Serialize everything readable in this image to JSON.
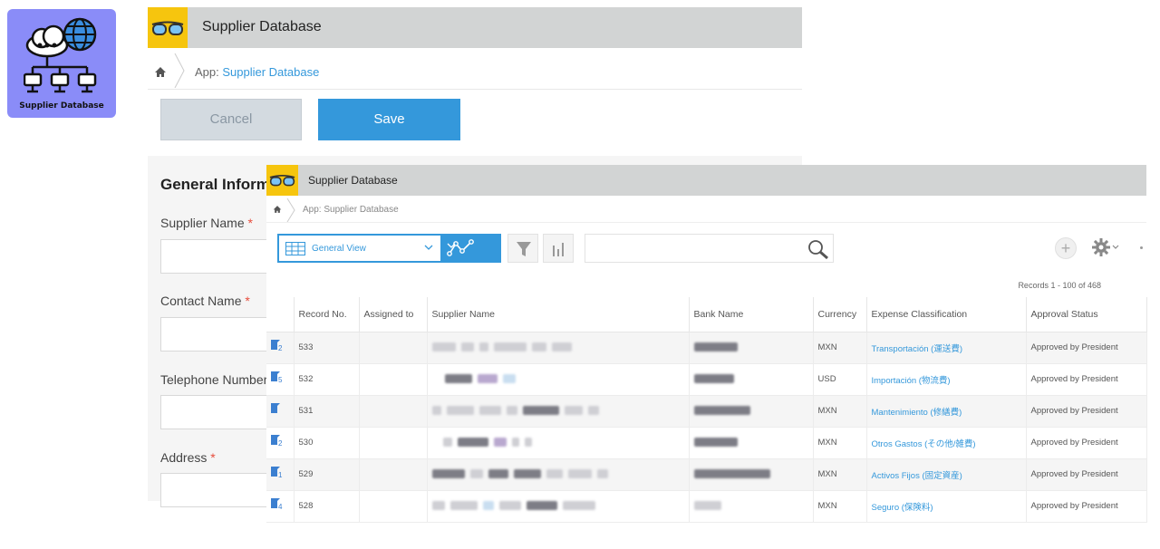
{
  "app_tile": {
    "label": "Supplier Database",
    "bg_color": "#8a8cf8",
    "icon": "cloud-network-icon"
  },
  "back_window": {
    "title": "Supplier Database",
    "breadcrumb": {
      "prefix": "App: ",
      "link": "Supplier Database"
    },
    "cancel_label": "Cancel",
    "save_label": "Save",
    "section_title": "General Inform",
    "fields": [
      {
        "label": "Supplier Name",
        "required": "*"
      },
      {
        "label": "Contact Name",
        "required": "*"
      },
      {
        "label": "Telephone Number",
        "required": ""
      },
      {
        "label": "Address",
        "required": "*"
      }
    ]
  },
  "front_window": {
    "title": "Supplier Database",
    "breadcrumb": "App: Supplier Database",
    "view_select": "General View",
    "records_count": "Records 1 - 100 of 468",
    "columns": [
      "",
      "Record No.",
      "Assigned to",
      "Supplier Name",
      "Bank Name",
      "Currency",
      "Expense Classification",
      "Approval Status"
    ],
    "rows": [
      {
        "icon_num": "2",
        "record_no": "533",
        "currency": "MXN",
        "expense": "Transportación (運送費)",
        "status": "Approved by President"
      },
      {
        "icon_num": "5",
        "record_no": "532",
        "currency": "USD",
        "expense": "Importación (物流費)",
        "status": "Approved by President"
      },
      {
        "icon_num": "",
        "record_no": "531",
        "currency": "MXN",
        "expense": "Mantenimiento (修繕費)",
        "status": "Approved by President"
      },
      {
        "icon_num": "2",
        "record_no": "530",
        "currency": "MXN",
        "expense": "Otros Gastos (その他/雑費)",
        "status": "Approved by President"
      },
      {
        "icon_num": "1",
        "record_no": "529",
        "currency": "MXN",
        "expense": "Activos Fijos (固定資産)",
        "status": "Approved by President"
      },
      {
        "icon_num": "4",
        "record_no": "528",
        "currency": "MXN",
        "expense": "Seguro (保険料)",
        "status": "Approved by President"
      }
    ]
  },
  "colors": {
    "accent": "#3498db",
    "app_yellow": "#f6c50e",
    "header_gray": "#d2d4d4",
    "required_red": "#e74c3c"
  }
}
